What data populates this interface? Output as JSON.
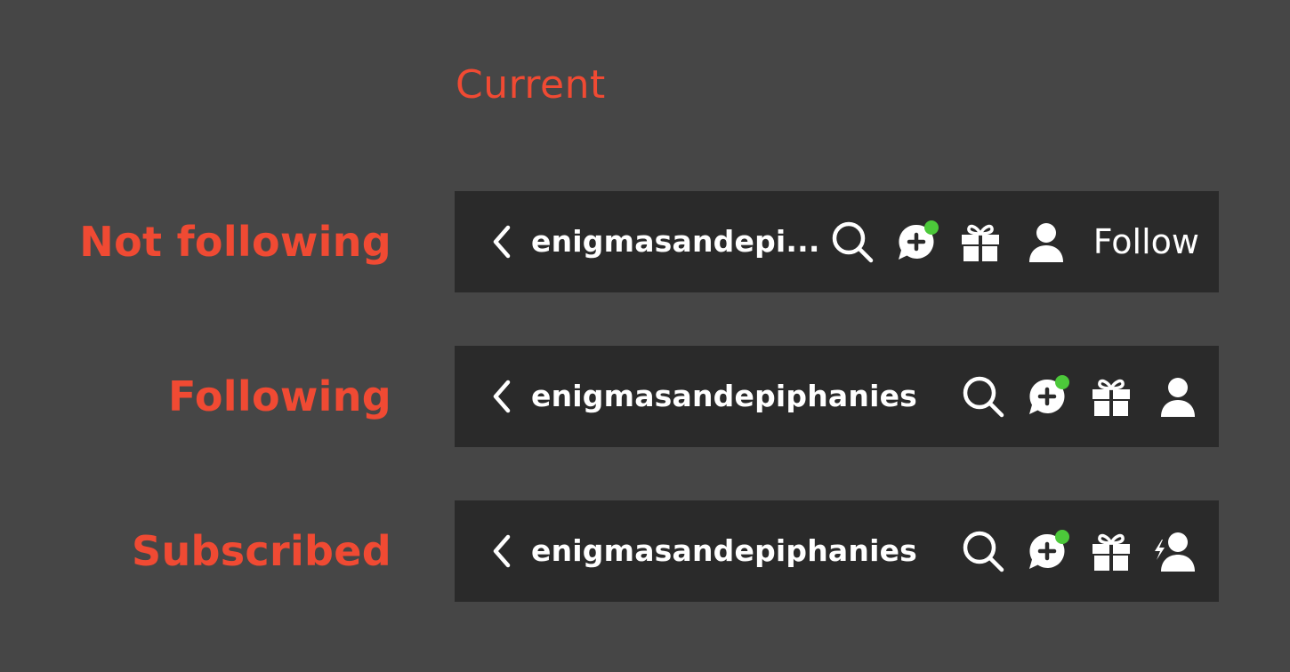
{
  "heading": "Current",
  "colors": {
    "background": "#464646",
    "bar": "#2a2a2a",
    "label": "#f04a33",
    "text": "#ffffff",
    "notification_dot": "#4cc83a"
  },
  "rows": [
    {
      "state_label": "Not following",
      "username": "enigmasandepi...",
      "icons": [
        "back-chevron-icon",
        "search-icon",
        "chat-plus-icon",
        "gift-icon",
        "person-icon"
      ],
      "follow_label": "Follow"
    },
    {
      "state_label": "Following",
      "username": "enigmasandepiphanies",
      "icons": [
        "back-chevron-icon",
        "search-icon",
        "chat-plus-icon",
        "gift-icon",
        "person-icon"
      ]
    },
    {
      "state_label": "Subscribed",
      "username": "enigmasandepiphanies",
      "icons": [
        "back-chevron-icon",
        "search-icon",
        "chat-plus-icon",
        "gift-icon",
        "person-bolt-icon"
      ]
    }
  ]
}
